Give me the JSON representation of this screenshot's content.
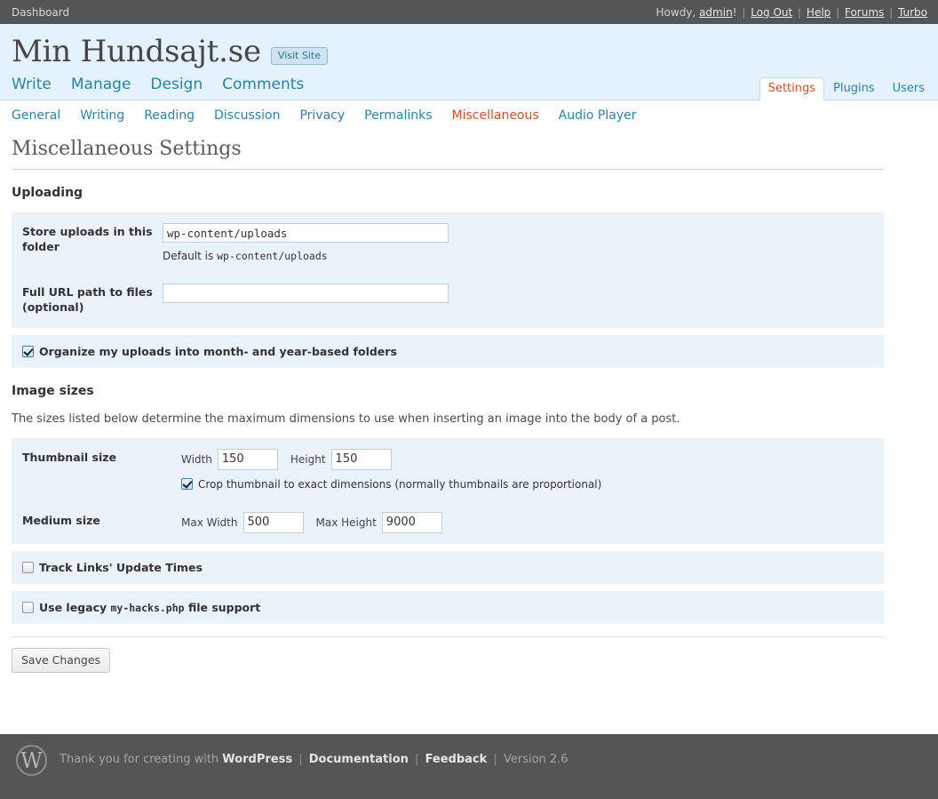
{
  "adminbar": {
    "dashboard_label": "Dashboard",
    "howdy_prefix": "Howdy,",
    "user": "admin",
    "user_suffix": "!",
    "links": [
      "Log Out",
      "Help",
      "Forums",
      "Turbo"
    ]
  },
  "header": {
    "blog_name": "Min Hundsajt.se",
    "visit_site_label": "Visit Site",
    "main_nav": [
      "Write",
      "Manage",
      "Design",
      "Comments"
    ],
    "right_tabs": [
      {
        "label": "Settings",
        "active": true
      },
      {
        "label": "Plugins",
        "active": false
      },
      {
        "label": "Users",
        "active": false
      }
    ]
  },
  "subnav": {
    "items": [
      {
        "label": "General",
        "active": false
      },
      {
        "label": "Writing",
        "active": false
      },
      {
        "label": "Reading",
        "active": false
      },
      {
        "label": "Discussion",
        "active": false
      },
      {
        "label": "Privacy",
        "active": false
      },
      {
        "label": "Permalinks",
        "active": false
      },
      {
        "label": "Miscellaneous",
        "active": true
      },
      {
        "label": "Audio Player",
        "active": false
      }
    ]
  },
  "page": {
    "title": "Miscellaneous Settings"
  },
  "uploading": {
    "heading": "Uploading",
    "store_folder_label": "Store uploads in this folder",
    "store_folder_value": "wp-content/uploads",
    "store_folder_default_prefix": "Default is",
    "store_folder_default_code": "wp-content/uploads",
    "full_url_label": "Full URL path to files (optional)",
    "full_url_value": "",
    "organize_label": "Organize my uploads into month- and year-based folders",
    "organize_checked": true
  },
  "image_sizes": {
    "heading": "Image sizes",
    "description": "The sizes listed below determine the maximum dimensions to use when inserting an image into the body of a post.",
    "thumbnail_label": "Thumbnail size",
    "thumb_width_label": "Width",
    "thumb_width_value": "150",
    "thumb_height_label": "Height",
    "thumb_height_value": "150",
    "crop_label": "Crop thumbnail to exact dimensions (normally thumbnails are proportional)",
    "crop_checked": true,
    "medium_label": "Medium size",
    "medium_width_label": "Max Width",
    "medium_width_value": "500",
    "medium_height_label": "Max Height",
    "medium_height_value": "9000"
  },
  "misc_options": {
    "track_links_label": "Track Links' Update Times",
    "track_links_checked": false,
    "legacy_prefix": "Use legacy",
    "legacy_code": "my-hacks.php",
    "legacy_suffix": "file support",
    "legacy_checked": false
  },
  "submit": {
    "save_label": "Save Changes"
  },
  "footer": {
    "logo_glyph": "W",
    "thanks_text": "Thank you for creating with",
    "wordpress_label": "WordPress",
    "documentation_label": "Documentation",
    "feedback_label": "Feedback",
    "version_label": "Version 2.6"
  },
  "colors": {
    "accent_blue": "#2683ae",
    "active_orange": "#d54e21",
    "header_bg": "#e4f2fd",
    "row_bg": "#eaf2fa",
    "bar_bg": "#555555"
  }
}
